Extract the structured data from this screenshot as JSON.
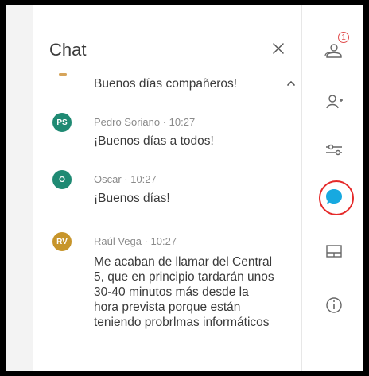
{
  "chat": {
    "title": "Chat",
    "messages": [
      {
        "avatar": "",
        "meta": "",
        "text": "Buenos días compañeros!"
      },
      {
        "avatar": "PS",
        "meta": "Pedro Soriano · 10:27",
        "text": "¡Buenos días a todos!"
      },
      {
        "avatar": "O",
        "meta": "Oscar · 10:27",
        "text": "¡Buenos días!"
      },
      {
        "avatar": "RV",
        "meta": "Raúl Vega · 10:27",
        "text": "Me acaban de llamar del Central 5, que en principio tardarán unos 30-40 minutos más desde la hora prevista porque están teniendo probrlmas informáticos"
      }
    ]
  },
  "rail": {
    "participants_badge": "1"
  },
  "colors": {
    "ps_avatar": "#1f8a73",
    "o_avatar": "#1f8a73",
    "rv_avatar": "#c7952b",
    "chat_active": "#17a9e0",
    "highlight": "#e52a2a"
  },
  "icons": {
    "close": "close-icon",
    "scroll_up": "chevron-up-icon",
    "participants": "participants-icon",
    "add_person": "add-person-icon",
    "controls": "sliders-icon",
    "chat": "chat-bubble-icon",
    "layout": "layout-icon",
    "info": "info-icon"
  }
}
